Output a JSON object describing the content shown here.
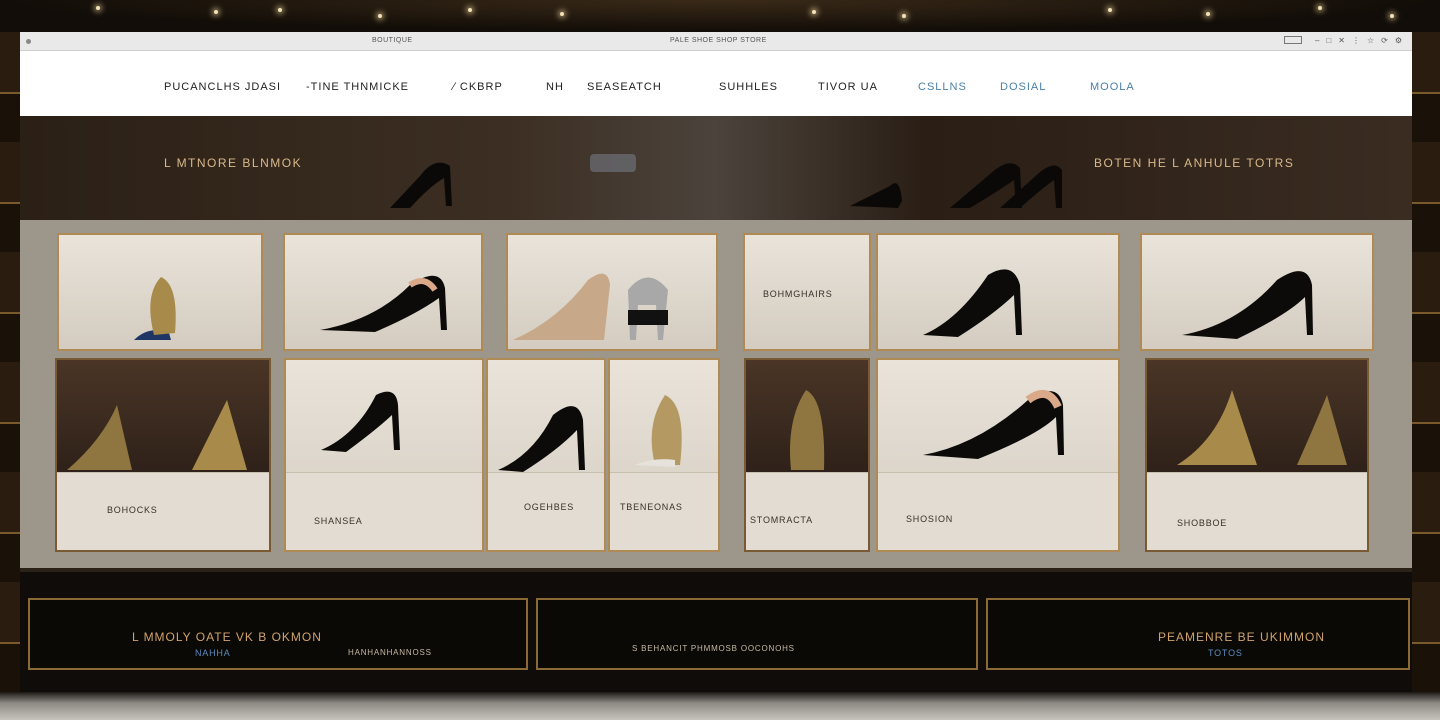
{
  "browser": {
    "tab_title": "BOUTIQUE",
    "url": "PALE SHOE SHOP STORE",
    "controls": [
      "–",
      "□",
      "✕",
      "⋮",
      "☆",
      "⟳",
      "⚙"
    ]
  },
  "nav": {
    "items": [
      {
        "label": "PUCANCLHS JDASI"
      },
      {
        "label": "-TINE  THNMICKE"
      },
      {
        "label": "∕ CKBRP"
      },
      {
        "label": "NH"
      },
      {
        "label": "SEASEATCH"
      },
      {
        "label": "SUHHLES"
      },
      {
        "label": "TIVOR UA"
      },
      {
        "label": "CSLLNS"
      },
      {
        "label": "DOSIAL"
      },
      {
        "label": "MOOLA"
      }
    ]
  },
  "hero": {
    "left_title": "L MTNORE  BLNMOK",
    "right_title": "BOTEN  HE  L ANHULE  TOTRS"
  },
  "grid": {
    "top_row": [
      {
        "label": ""
      },
      {
        "label": ""
      },
      {
        "label": ""
      },
      {
        "label": "BOHMGHAIRS"
      },
      {
        "label": ""
      },
      {
        "label": ""
      }
    ],
    "bottom_row": [
      {
        "label": "BOHOCKS"
      },
      {
        "label": "SHANSEA"
      },
      {
        "label": "OGEHBES"
      },
      {
        "label": "TBENEONAS"
      },
      {
        "label": "STOMRACTA"
      },
      {
        "label": "SHOSION"
      },
      {
        "label": "SHOBBOE"
      }
    ]
  },
  "footer": {
    "left_title": "L MMOLY  OATE  VK  B  OKMON",
    "left_link": "NAHHA",
    "left_subtext": "HANHANHANNOSS",
    "center_text": "S BEHANCIT PHMMOSB OOCONOHS",
    "right_title": "PEAMENRE  BE  UKIMMON",
    "right_link": "TOTOS"
  },
  "colors": {
    "accent_gold": "#b08a55",
    "link_blue": "#4a7fa8",
    "background": "#0d0a07"
  }
}
